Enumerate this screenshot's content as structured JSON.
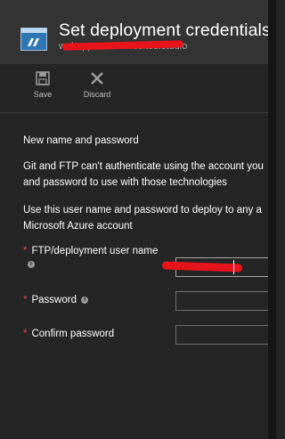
{
  "header": {
    "title": "Set deployment credentials",
    "subtitle": "webapp.azurewebsites.studio"
  },
  "toolbar": {
    "save_label": "Save",
    "discard_label": "Discard"
  },
  "form": {
    "section_title": "New name and password",
    "description_1_line1": "Git and FTP can't authenticate using the account you",
    "description_1_line2": "and password to use with those technologies",
    "description_2_line1": "Use this user name and password to deploy to any a",
    "description_2_line2": "Microsoft Azure account",
    "required_mark": "*",
    "info_glyph": "i",
    "username_label": "FTP/deployment user name",
    "username_value": "",
    "password_label": "Password",
    "password_value": "",
    "confirm_password_label": "Confirm password",
    "confirm_password_value": ""
  },
  "colors": {
    "header_bg": "#333333",
    "panel_bg": "#252526",
    "required": "#e0494a",
    "icon_blue": "#2f77b3"
  },
  "icons": {
    "header": "web-app-icon",
    "save": "save-icon",
    "discard": "close-icon",
    "info": "info-icon"
  }
}
